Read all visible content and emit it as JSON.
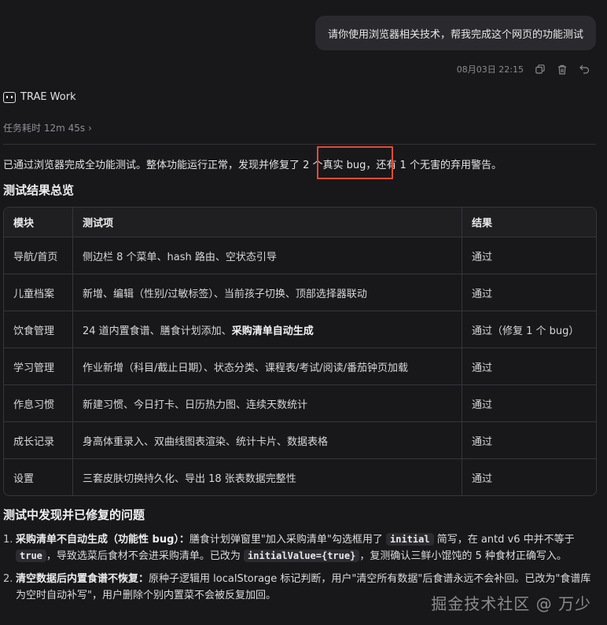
{
  "user_message": "请你使用浏览器相关技术，帮我完成这个网页的功能测试",
  "message_time": "08月03日 22:15",
  "assistant_name": "TRAE Work",
  "task_time": "任务耗时 12m 45s",
  "summary": "已通过浏览器完成全功能测试。整体功能运行正常，发现并修复了 2 个真实 bug，还有 1 个无害的弃用警告。",
  "overview_title": "测试结果总览",
  "table": {
    "headers": [
      "模块",
      "测试项",
      "结果"
    ],
    "rows": [
      {
        "module": "导航/首页",
        "items": "侧边栏 8 个菜单、hash 路由、空状态引导",
        "items_bold": "",
        "result": "通过"
      },
      {
        "module": "儿童档案",
        "items": "新增、编辑（性别/过敏标签）、当前孩子切换、顶部选择器联动",
        "items_bold": "",
        "result": "通过"
      },
      {
        "module": "饮食管理",
        "items": "24 道内置食谱、膳食计划添加、",
        "items_bold": "采购清单自动生成",
        "result": "通过（修复 1 个 bug）"
      },
      {
        "module": "学习管理",
        "items": "作业新增（科目/截止日期）、状态分类、课程表/考试/阅读/番茄钟页加载",
        "items_bold": "",
        "result": "通过"
      },
      {
        "module": "作息习惯",
        "items": "新建习惯、今日打卡、日历热力图、连续天数统计",
        "items_bold": "",
        "result": "通过"
      },
      {
        "module": "成长记录",
        "items": "身高体重录入、双曲线图表渲染、统计卡片、数据表格",
        "items_bold": "",
        "result": "通过"
      },
      {
        "module": "设置",
        "items": "三套皮肤切换持久化、导出 18 张表数据完整性",
        "items_bold": "",
        "result": "通过"
      }
    ]
  },
  "fixed_title": "测试中发现并已修复的问题",
  "issues": [
    {
      "num": "1.",
      "title": "采购清单不自动生成（功能性 bug）：",
      "t1": "膳食计划弹窗里\"加入采购清单\"勾选框用了 ",
      "code1": "initial",
      "t2": " 简写，在 antd v6 中并不等于 ",
      "code2": "true",
      "t3": "，导致选菜后食材不会进采购清单。已改为 ",
      "code3": "initialValue={true}",
      "t4": "，复测确认三鲜小馄饨的 5 种食材正确写入。"
    },
    {
      "num": "2.",
      "title": "清空数据后内置食谱不恢复：",
      "t1": "原种子逻辑用 localStorage 标记判断，用户\"清空所有数据\"后食谱永远不会补回。已改为\"食谱库为空时自动补写\"，用户删除个别内置菜不会被反复加回。"
    }
  ],
  "watermark": "掘金技术社区 @ 万少"
}
